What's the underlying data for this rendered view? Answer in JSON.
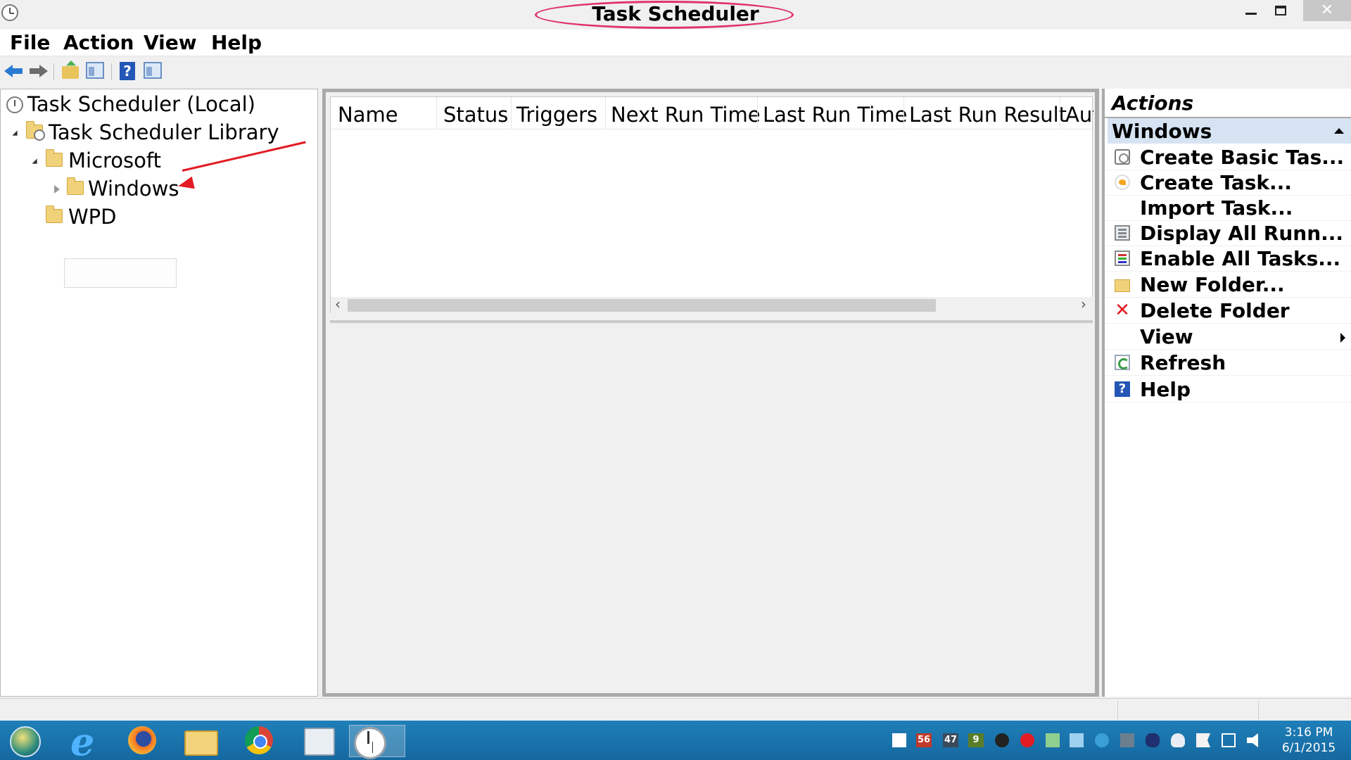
{
  "window": {
    "title": "Task Scheduler",
    "close_glyph": "✕"
  },
  "menu": {
    "items": [
      "File",
      "Action",
      "View",
      "Help"
    ]
  },
  "toolbar": {
    "help_glyph": "?"
  },
  "tree": {
    "root": "Task Scheduler (Local)",
    "library": "Task Scheduler Library",
    "microsoft": "Microsoft",
    "windows": "Windows",
    "wpd": "WPD"
  },
  "grid": {
    "columns": [
      "Name",
      "Status",
      "Triggers",
      "Next Run Time",
      "Last Run Time",
      "Last Run Result",
      "Aut"
    ],
    "rows": [],
    "scroll_left": "‹",
    "scroll_right": "›"
  },
  "actions": {
    "title": "Actions",
    "section": "Windows",
    "items": [
      {
        "label": "Create Basic Tas...",
        "icon": "create-basic-task-icon"
      },
      {
        "label": "Create Task...",
        "icon": "create-task-icon"
      },
      {
        "label": "Import Task...",
        "icon": ""
      },
      {
        "label": "Display All Runn...",
        "icon": "display-running-icon"
      },
      {
        "label": "Enable All Tasks...",
        "icon": "enable-history-icon"
      },
      {
        "label": "New Folder...",
        "icon": "new-folder-icon"
      },
      {
        "label": "Delete Folder",
        "icon": "delete-icon"
      },
      {
        "label": "View",
        "icon": ""
      },
      {
        "label": "Refresh",
        "icon": "refresh-icon"
      },
      {
        "label": "Help",
        "icon": "help-icon"
      }
    ],
    "delete_glyph": "✕",
    "help_glyph": "?"
  },
  "taskbar": {
    "badges": [
      "56",
      "47",
      "9"
    ],
    "time": "3:16 PM",
    "date": "6/1/2015"
  },
  "colors": {
    "accent": "#e0336e",
    "annotation_arrow": "#e31b23",
    "taskbar": "#1a74ad",
    "actions_header": "#d6e3f2"
  }
}
